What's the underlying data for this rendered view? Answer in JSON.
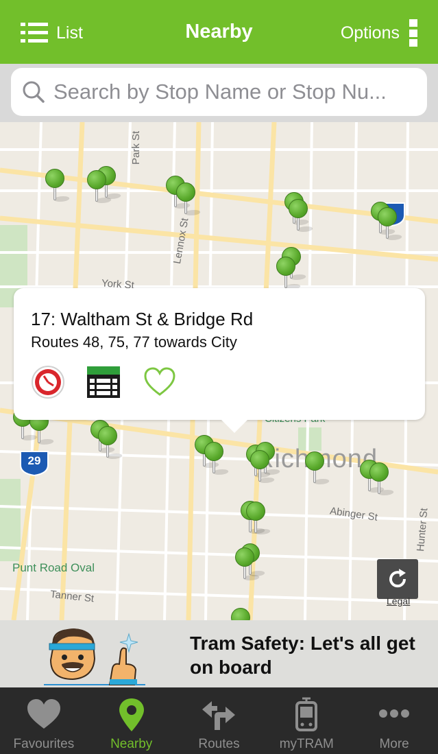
{
  "header": {
    "list_label": "List",
    "title": "Nearby",
    "options_label": "Options"
  },
  "search": {
    "placeholder": "Search by Stop Name or Stop Nu..."
  },
  "map": {
    "street_labels": [
      "Park St",
      "Lennox St",
      "York St",
      "Abinger St",
      "Hunter St",
      "Tanner St",
      "Punt Road Oval",
      "Citizens Park",
      "Richmond"
    ],
    "route_shields": [
      "29"
    ],
    "legal_label": "Legal"
  },
  "callout": {
    "title": "17: Waltham St & Bridge Rd",
    "subtitle": "Routes 48, 75, 77 towards City"
  },
  "banner": {
    "text": "Tram Safety: Let's all get on board"
  },
  "tabs": [
    {
      "label": "Favourites",
      "icon": "heart-icon",
      "active": false
    },
    {
      "label": "Nearby",
      "icon": "location-pin-icon",
      "active": true
    },
    {
      "label": "Routes",
      "icon": "route-arrows-icon",
      "active": false
    },
    {
      "label": "myTRAM",
      "icon": "tram-icon",
      "active": false
    },
    {
      "label": "More",
      "icon": "more-dots-icon",
      "active": false
    }
  ],
  "colors": {
    "brand_green": "#72bf2b",
    "tab_bar": "#2a2a2a",
    "tab_inactive": "#8f8f8f"
  }
}
